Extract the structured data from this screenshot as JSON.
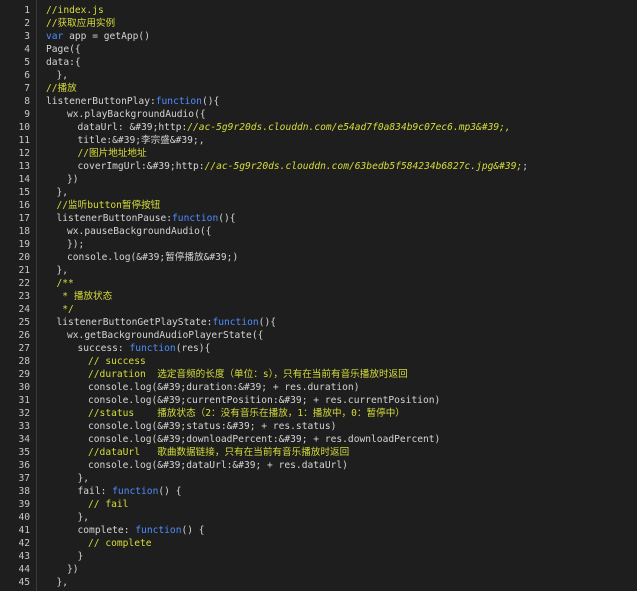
{
  "editor": {
    "colors": {
      "background": "#1e1e1e",
      "text": "#d4d4d4",
      "comment": "#d6dc3a",
      "keyword": "#4f8cff",
      "line_number": "#c8c8c8"
    },
    "lines": [
      {
        "n": "1",
        "indent": 0,
        "tokens": [
          {
            "t": "//index.js",
            "c": "cm"
          }
        ]
      },
      {
        "n": "2",
        "indent": 0,
        "tokens": [
          {
            "t": "//获取应用实例",
            "c": "cm"
          }
        ]
      },
      {
        "n": "3",
        "indent": 0,
        "tokens": [
          {
            "t": "var",
            "c": "kw"
          },
          {
            "t": " app = getApp()",
            "c": "pl"
          }
        ]
      },
      {
        "n": "4",
        "indent": 0,
        "tokens": [
          {
            "t": "Page({",
            "c": "pl"
          }
        ]
      },
      {
        "n": "5",
        "indent": 0,
        "tokens": [
          {
            "t": "data:{",
            "c": "pl"
          }
        ]
      },
      {
        "n": "6",
        "indent": 1,
        "tokens": [
          {
            "t": "},",
            "c": "pl"
          }
        ]
      },
      {
        "n": "7",
        "indent": 0,
        "tokens": [
          {
            "t": "//播放",
            "c": "cm"
          }
        ]
      },
      {
        "n": "8",
        "indent": 0,
        "tokens": [
          {
            "t": "listenerButtonPlay:",
            "c": "pl"
          },
          {
            "t": "function",
            "c": "kw"
          },
          {
            "t": "(){",
            "c": "pl"
          }
        ]
      },
      {
        "n": "9",
        "indent": 2,
        "tokens": [
          {
            "t": "wx.playBackgroundAudio({",
            "c": "pl"
          }
        ]
      },
      {
        "n": "10",
        "indent": 3,
        "tokens": [
          {
            "t": "dataUrl: &#39;http:",
            "c": "pl"
          },
          {
            "t": "//ac-5g9r20ds.clouddn.com/e54ad7f0a834b9c07ec6.mp3&#39;,",
            "c": "str"
          }
        ]
      },
      {
        "n": "11",
        "indent": 3,
        "tokens": [
          {
            "t": "title:&#39;李宗盛&#39;,",
            "c": "pl"
          }
        ]
      },
      {
        "n": "12",
        "indent": 3,
        "tokens": [
          {
            "t": "//图片地址地址",
            "c": "cm"
          }
        ]
      },
      {
        "n": "13",
        "indent": 3,
        "tokens": [
          {
            "t": "coverImgUrl:&#39;http:",
            "c": "pl"
          },
          {
            "t": "//ac-5g9r20ds.clouddn.com/63bedb5f584234b6827c.jpg&#39;",
            "c": "str"
          },
          {
            "t": ";",
            "c": "pl"
          }
        ]
      },
      {
        "n": "14",
        "indent": 2,
        "tokens": [
          {
            "t": "})",
            "c": "pl"
          }
        ]
      },
      {
        "n": "15",
        "indent": 1,
        "tokens": [
          {
            "t": "},",
            "c": "pl"
          }
        ]
      },
      {
        "n": "16",
        "indent": 1,
        "tokens": [
          {
            "t": "//监听button暂停按钮",
            "c": "cm"
          }
        ]
      },
      {
        "n": "17",
        "indent": 1,
        "tokens": [
          {
            "t": "listenerButtonPause:",
            "c": "pl"
          },
          {
            "t": "function",
            "c": "kw"
          },
          {
            "t": "(){",
            "c": "pl"
          }
        ]
      },
      {
        "n": "18",
        "indent": 2,
        "tokens": [
          {
            "t": "wx.pauseBackgroundAudio({",
            "c": "pl"
          }
        ]
      },
      {
        "n": "19",
        "indent": 2,
        "tokens": [
          {
            "t": "});",
            "c": "pl"
          }
        ]
      },
      {
        "n": "20",
        "indent": 2,
        "tokens": [
          {
            "t": "console.log(&#39;暂停播放&#39;)",
            "c": "pl"
          }
        ]
      },
      {
        "n": "21",
        "indent": 1,
        "tokens": [
          {
            "t": "},",
            "c": "pl"
          }
        ]
      },
      {
        "n": "22",
        "indent": 1,
        "tokens": [
          {
            "t": "/**",
            "c": "cm"
          }
        ]
      },
      {
        "n": "23",
        "indent": 1,
        "tokens": [
          {
            "t": " * 播放状态",
            "c": "cm"
          }
        ]
      },
      {
        "n": "24",
        "indent": 1,
        "tokens": [
          {
            "t": " */",
            "c": "cm"
          }
        ]
      },
      {
        "n": "25",
        "indent": 1,
        "tokens": [
          {
            "t": "listenerButtonGetPlayState:",
            "c": "pl"
          },
          {
            "t": "function",
            "c": "kw"
          },
          {
            "t": "(){",
            "c": "pl"
          }
        ]
      },
      {
        "n": "26",
        "indent": 2,
        "tokens": [
          {
            "t": "wx.getBackgroundAudioPlayerState({",
            "c": "pl"
          }
        ]
      },
      {
        "n": "27",
        "indent": 3,
        "tokens": [
          {
            "t": "success: ",
            "c": "pl"
          },
          {
            "t": "function",
            "c": "kw"
          },
          {
            "t": "(res){",
            "c": "pl"
          }
        ]
      },
      {
        "n": "28",
        "indent": 4,
        "tokens": [
          {
            "t": "// success",
            "c": "cm"
          }
        ]
      },
      {
        "n": "29",
        "indent": 4,
        "tokens": [
          {
            "t": "//duration  选定音频的长度（单位：s），只有在当前有音乐播放时返回",
            "c": "cm"
          }
        ]
      },
      {
        "n": "30",
        "indent": 4,
        "tokens": [
          {
            "t": "console.log(&#39;duration:&#39; + res.duration)",
            "c": "pl"
          }
        ]
      },
      {
        "n": "31",
        "indent": 4,
        "tokens": [
          {
            "t": "console.log(&#39;currentPosition:&#39; + res.currentPosition)",
            "c": "pl"
          }
        ]
      },
      {
        "n": "32",
        "indent": 4,
        "tokens": [
          {
            "t": "//status    播放状态（2：没有音乐在播放，1：播放中，0：暂停中）",
            "c": "cm"
          }
        ]
      },
      {
        "n": "33",
        "indent": 4,
        "tokens": [
          {
            "t": "console.log(&#39;status:&#39; + res.status)",
            "c": "pl"
          }
        ]
      },
      {
        "n": "34",
        "indent": 4,
        "tokens": [
          {
            "t": "console.log(&#39;downloadPercent:&#39; + res.downloadPercent)",
            "c": "pl"
          }
        ]
      },
      {
        "n": "35",
        "indent": 4,
        "tokens": [
          {
            "t": "//dataUrl   歌曲数据链接，只有在当前有音乐播放时返回",
            "c": "cm"
          }
        ]
      },
      {
        "n": "36",
        "indent": 4,
        "tokens": [
          {
            "t": "console.log(&#39;dataUrl:&#39; + res.dataUrl)",
            "c": "pl"
          }
        ]
      },
      {
        "n": "37",
        "indent": 3,
        "tokens": [
          {
            "t": "},",
            "c": "pl"
          }
        ]
      },
      {
        "n": "38",
        "indent": 3,
        "tokens": [
          {
            "t": "fail: ",
            "c": "pl"
          },
          {
            "t": "function",
            "c": "kw"
          },
          {
            "t": "() {",
            "c": "pl"
          }
        ]
      },
      {
        "n": "39",
        "indent": 4,
        "tokens": [
          {
            "t": "// fail",
            "c": "cm"
          }
        ]
      },
      {
        "n": "40",
        "indent": 3,
        "tokens": [
          {
            "t": "},",
            "c": "pl"
          }
        ]
      },
      {
        "n": "41",
        "indent": 3,
        "tokens": [
          {
            "t": "complete: ",
            "c": "pl"
          },
          {
            "t": "function",
            "c": "kw"
          },
          {
            "t": "() {",
            "c": "pl"
          }
        ]
      },
      {
        "n": "42",
        "indent": 4,
        "tokens": [
          {
            "t": "// complete",
            "c": "cm"
          }
        ]
      },
      {
        "n": "43",
        "indent": 3,
        "tokens": [
          {
            "t": "}",
            "c": "pl"
          }
        ]
      },
      {
        "n": "44",
        "indent": 2,
        "tokens": [
          {
            "t": "})",
            "c": "pl"
          }
        ]
      },
      {
        "n": "45",
        "indent": 1,
        "tokens": [
          {
            "t": "},",
            "c": "pl"
          }
        ]
      }
    ]
  }
}
